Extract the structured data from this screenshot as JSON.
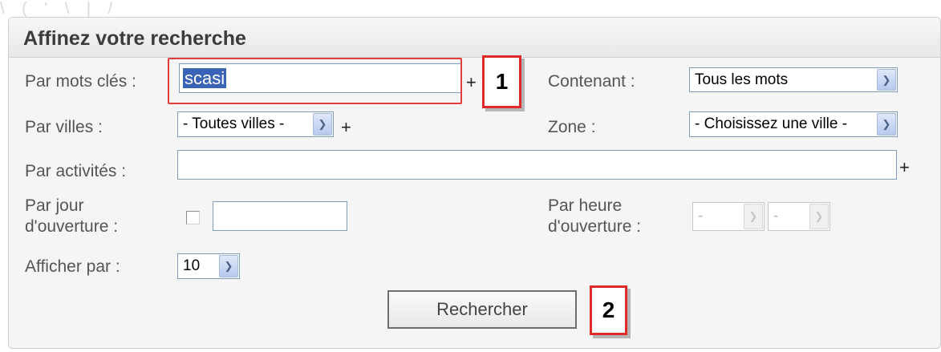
{
  "panel": {
    "title": "Affinez votre recherche"
  },
  "form": {
    "keywords_label": "Par mots clés :",
    "keywords_value": "scasi",
    "plus_symbol": "+",
    "containing_label": "Contenant :",
    "containing_value": "Tous les mots",
    "cities_label": "Par villes :",
    "cities_value": "- Toutes villes -",
    "zone_label": "Zone :",
    "zone_value": "- Choisissez une ville -",
    "activities_label": "Par activités :",
    "activities_value": "",
    "opening_day_label_line1": "Par jour",
    "opening_day_label_line2": "d'ouverture :",
    "opening_day_checked": false,
    "opening_day_value": "",
    "opening_hour_label_line1": "Par heure",
    "opening_hour_label_line2": "d'ouverture :",
    "hour_from_value": "-",
    "hour_to_value": "-",
    "display_label": "Afficher par :",
    "display_value": "10",
    "search_button": "Rechercher"
  },
  "annotations": {
    "callout_1": "1",
    "callout_2": "2",
    "highlight_color": "#e43d3d"
  },
  "icons": {
    "dropdown_arrow": "chevron-down-icon"
  }
}
